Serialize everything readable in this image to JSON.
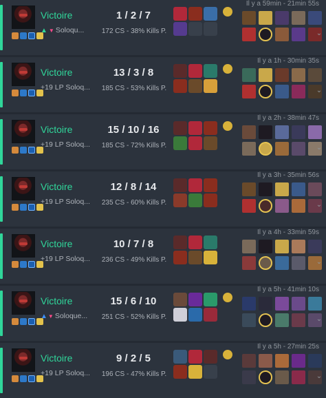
{
  "matches": [
    {
      "result": "Victoire",
      "rank_change": "",
      "queue": "Soloqu...",
      "rank_icon": "triangle-up-down",
      "kda": "1 / 2 / 7",
      "stats": "172 CS - 38% Kills P.",
      "time": "Il y a 59min - 21min 55s",
      "items": [
        "#b1283a",
        "#8a2d1e",
        "#3a6ea8",
        "#553b8f",
        "",
        ""
      ],
      "trinket": "#d8b23a",
      "champs_top": [
        "#6a4a2a",
        "#c9a84a",
        "#4a3a6a",
        "#7a6a5a",
        "#3a4a7a"
      ],
      "champs_bot": [
        "#b03030",
        "#1e1a22",
        "#8a5a3a",
        "#5a3a8a",
        "#7a2a2a"
      ]
    },
    {
      "result": "Victoire",
      "rank_change": "+19 LP",
      "queue": "Soloq...",
      "rank_icon": "",
      "kda": "13 / 3 / 8",
      "stats": "185 CS - 53% Kills P.",
      "time": "Il y a 1h - 30min 35s",
      "items": [
        "#5a2a2a",
        "#b1283a",
        "#2a7a6a",
        "#8a2d1e",
        "#6a4a2a",
        "#d8a03a"
      ],
      "trinket": "#d8b23a",
      "champs_top": [
        "#3a6a5a",
        "#c9a84a",
        "#6a3a2a",
        "#8a6a4a",
        "#5a4a3a"
      ],
      "champs_bot": [
        "#b03030",
        "#1e1a22",
        "#3a5a8a",
        "#8a2a5a",
        "#4a3a2a"
      ]
    },
    {
      "result": "Victoire",
      "rank_change": "+19 LP",
      "queue": "Soloq...",
      "rank_icon": "",
      "kda": "15 / 10 / 16",
      "stats": "185 CS - 72% Kills P.",
      "time": "Il y a 2h - 38min 47s",
      "items": [
        "#5a2a2a",
        "#b1283a",
        "#8a2d1e",
        "#3a7a3a",
        "#b1283a",
        "#6a4a2a"
      ],
      "trinket": "#d8b23a",
      "champs_top": [
        "#6a4a3a",
        "#1e1a22",
        "#5a6a9a",
        "#3a3a5a",
        "#8a6aaa"
      ],
      "champs_bot": [
        "#7a6a5a",
        "#c9a84a",
        "#9a6a3a",
        "#5a4a6a",
        "#8a7a6a"
      ]
    },
    {
      "result": "Victoire",
      "rank_change": "+19 LP",
      "queue": "Soloq...",
      "rank_icon": "",
      "kda": "12 / 8 / 14",
      "stats": "235 CS - 60% Kills P.",
      "time": "Il y a 3h - 35min 56s",
      "items": [
        "#5a2a2a",
        "#b1283a",
        "#8a2d1e",
        "#8a3a2a",
        "#3a7a3a",
        "#8a2d1e"
      ],
      "trinket": "",
      "champs_top": [
        "#6a4a2a",
        "#1e1a22",
        "#c9a84a",
        "#3a5a8a",
        "#6a4a5a"
      ],
      "champs_bot": [
        "#b03030",
        "#4a2a2a",
        "#8a5a8a",
        "#aa6a3a",
        "#6a3a4a"
      ]
    },
    {
      "result": "Victoire",
      "rank_change": "+19 LP",
      "queue": "Soloq...",
      "rank_icon": "",
      "kda": "10 / 7 / 8",
      "stats": "236 CS - 49% Kills P.",
      "time": "Il y a 4h - 33min 59s",
      "items": [
        "#5a2a2a",
        "#b1283a",
        "#2a7a6a",
        "#8a2d1e",
        "#6a4a2a",
        "#d8b23a"
      ],
      "trinket": "",
      "champs_top": [
        "#7a6a5a",
        "#1e1a22",
        "#c9a84a",
        "#aa7a5a",
        "#3a3a5a"
      ],
      "champs_bot": [
        "#8a3a3a",
        "#6a5a4a",
        "#3a6a9a",
        "#5a5a6a",
        "#9a6a3a"
      ]
    },
    {
      "result": "Victoire",
      "rank_change": "",
      "queue": "Soloque...",
      "rank_icon": "triangle-up-down-blue",
      "kda": "15 / 6 / 10",
      "stats": "251 CS - 52% Kills P.",
      "time": "Il y a 5h - 41min 10s",
      "items": [
        "#6a4a3a",
        "#6a2a9a",
        "#2a9a6a",
        "#cfcfd8",
        "#2a6aaa",
        "#9a2a3a"
      ],
      "trinket": "#d8b23a",
      "champs_top": [
        "#2a3a6a",
        "#2a2a3a",
        "#7a4a9a",
        "#6a4a8a",
        "#3a7a9a"
      ],
      "champs_bot": [
        "#3a4a5a",
        "#1e1a22",
        "#4a7a6a",
        "#6a3a4a",
        "#5a4a6a"
      ]
    },
    {
      "result": "Victoire",
      "rank_change": "+19 LP",
      "queue": "Soloq...",
      "rank_icon": "",
      "kda": "9 / 2 / 5",
      "stats": "196 CS - 47% Kills P.",
      "time": "Il y a 5h - 27min 25s",
      "items": [
        "#3a5a7a",
        "#b1283a",
        "#5a2a2a",
        "#8a2d1e",
        "#d8b23a",
        ""
      ],
      "trinket": "#d8b23a",
      "champs_top": [
        "#5a3a3a",
        "#8a5a4a",
        "#aa6a3a",
        "#6a2a8a",
        "#2a3a5a"
      ],
      "champs_bot": [
        "#3a3a4a",
        "#1e1a22",
        "#6a5a4a",
        "#8a2a4a",
        "#4a3a3a"
      ]
    }
  ]
}
